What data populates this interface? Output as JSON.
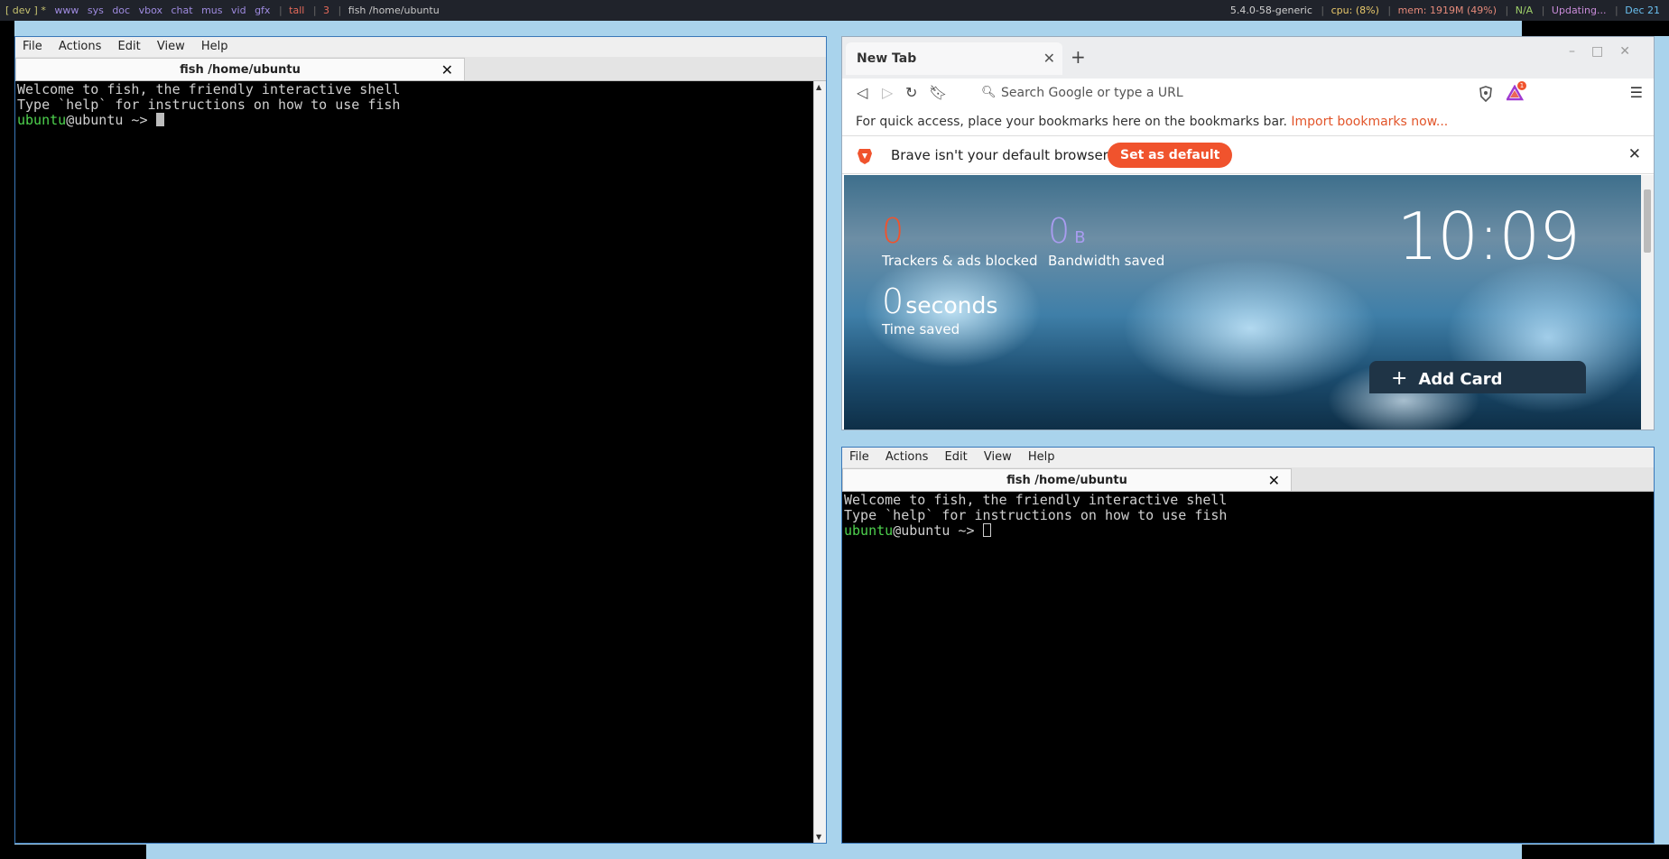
{
  "statusbar": {
    "left": [
      {
        "text": "[ dev ] *",
        "cls": "dev"
      },
      {
        "text": "www",
        "cls": "ws"
      },
      {
        "text": "sys",
        "cls": "ws"
      },
      {
        "text": "doc",
        "cls": "ws"
      },
      {
        "text": "vbox",
        "cls": "ws"
      },
      {
        "text": "chat",
        "cls": "ws"
      },
      {
        "text": "mus",
        "cls": "ws"
      },
      {
        "text": "vid",
        "cls": "ws"
      },
      {
        "text": "gfx",
        "cls": "ws"
      }
    ],
    "layout": "tall",
    "count": "3",
    "window_title": "fish /home/ubuntu",
    "kernel": "5.4.0-58-generic",
    "cpu": "cpu: (8%)",
    "mem": "mem: 1919M (49%)",
    "battery": "N/A",
    "updates": "Updating...",
    "date": "Dec 21"
  },
  "terminal_left": {
    "menu": [
      "File",
      "Actions",
      "Edit",
      "View",
      "Help"
    ],
    "tab_title": "fish /home/ubuntu",
    "lines": [
      "Welcome to fish, the friendly interactive shell",
      "Type `help` for instructions on how to use fish"
    ],
    "prompt_user": "ubuntu",
    "prompt_rest": "@ubuntu ~> "
  },
  "terminal_right": {
    "menu": [
      "File",
      "Actions",
      "Edit",
      "View",
      "Help"
    ],
    "tab_title": "fish /home/ubuntu",
    "lines": [
      "Welcome to fish, the friendly interactive shell",
      "Type `help` for instructions on how to use fish"
    ],
    "prompt_user": "ubuntu",
    "prompt_rest": "@ubuntu ~> "
  },
  "browser": {
    "tab_title": "New Tab",
    "new_tab": "+",
    "url_placeholder": "Search Google or type a URL",
    "bookmarks_text": "For quick access, place your bookmarks here on the bookmarks bar.",
    "bookmarks_link": "Import bookmarks now...",
    "infobar_message": "Brave isn't your default browser",
    "set_default": "Set as default",
    "rewards_badge": "1",
    "ntp": {
      "trackers_value": "0",
      "trackers_label": "Trackers & ads blocked",
      "bandwidth_value": "0",
      "bandwidth_unit": "B",
      "bandwidth_label": "Bandwidth saved",
      "time_value": "0",
      "time_unit": "seconds",
      "time_label": "Time saved",
      "clock": "10:09",
      "add_card": "Add Card"
    },
    "colors": {
      "accent": "#f0532d",
      "trackers": "#f0532d",
      "bandwidth": "#a99cf0"
    }
  }
}
